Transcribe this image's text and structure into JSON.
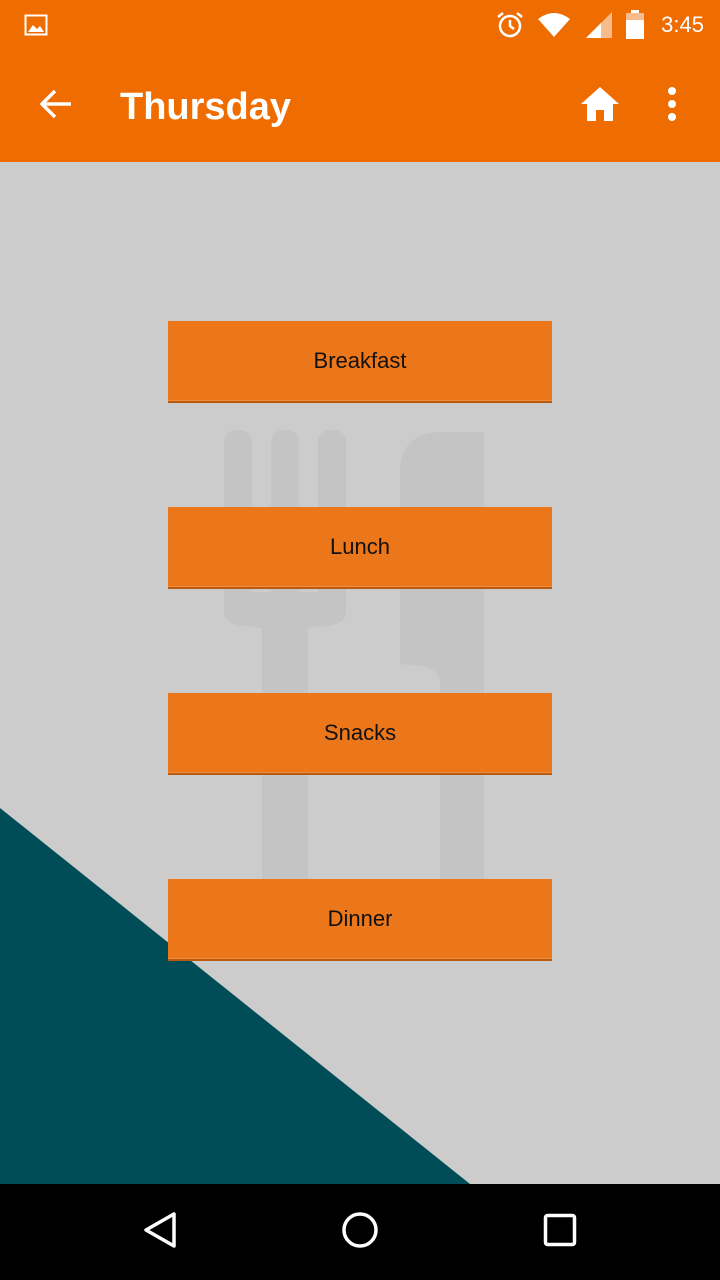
{
  "status_bar": {
    "time": "3:45",
    "icons": [
      "gallery-icon",
      "alarm-icon",
      "wifi-icon",
      "cell-signal-icon",
      "battery-icon"
    ]
  },
  "app_bar": {
    "title": "Thursday",
    "icons": [
      "back-arrow-icon",
      "home-icon",
      "overflow-menu-icon"
    ]
  },
  "meals": [
    {
      "label": "Breakfast"
    },
    {
      "label": "Lunch"
    },
    {
      "label": "Snacks"
    },
    {
      "label": "Dinner"
    }
  ],
  "nav_bar": {
    "icons": [
      "back-triangle-icon",
      "home-circle-icon",
      "recents-square-icon"
    ]
  },
  "colors": {
    "primary": "#ef6c00",
    "button": "#ec771b",
    "background": "#cccccc",
    "accent_triangle": "#004d57"
  }
}
